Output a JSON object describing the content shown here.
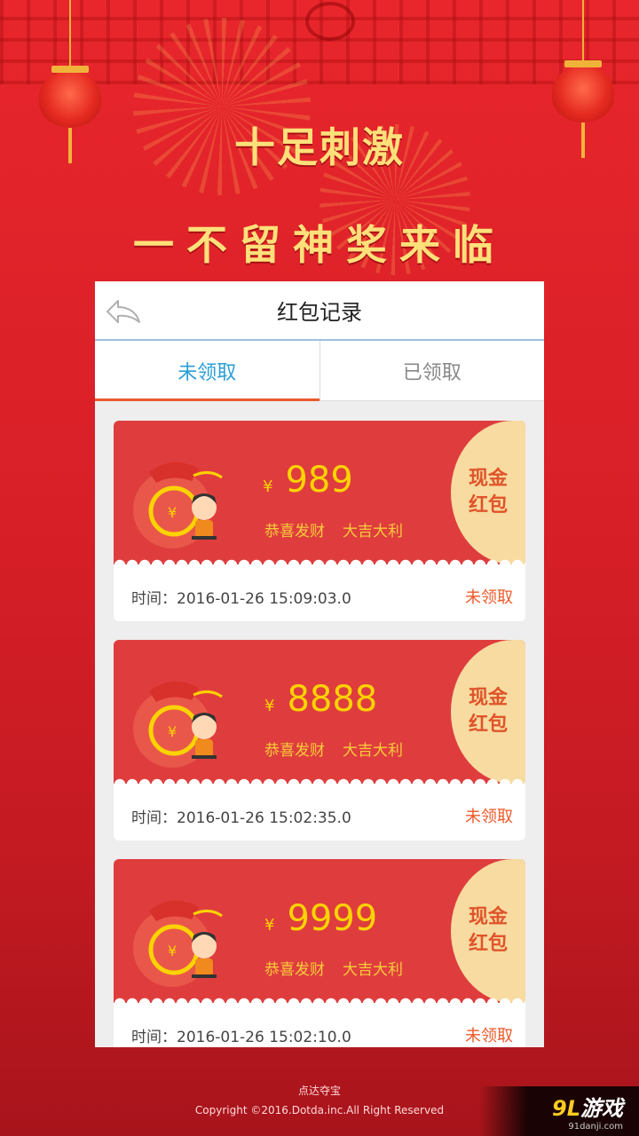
{
  "banner": {
    "headline_1": "十足刺激",
    "headline_2": "一不留神奖来临"
  },
  "panel": {
    "title": "红包记录",
    "tabs": [
      {
        "label": "未领取",
        "active": true
      },
      {
        "label": "已领取",
        "active": false
      }
    ]
  },
  "records": [
    {
      "currency": "¥",
      "amount": "989",
      "blessing_1": "恭喜发财",
      "blessing_2": "大吉大利",
      "badge": "现金红包",
      "time": "时间：2016-01-26 15:09:03.0",
      "status": "未领取"
    },
    {
      "currency": "¥",
      "amount": "8888",
      "blessing_1": "恭喜发财",
      "blessing_2": "大吉大利",
      "badge": "现金红包",
      "time": "时间：2016-01-26 15:02:35.0",
      "status": "未领取"
    },
    {
      "currency": "¥",
      "amount": "9999",
      "blessing_1": "恭喜发财",
      "blessing_2": "大吉大利",
      "badge": "现金红包",
      "time": "时间：2016-01-26 15:02:10.0",
      "status": "未领取"
    }
  ],
  "footer": {
    "app_name": "点达夺宝",
    "copyright": "Copyright ©2016.Dotda.inc.All Right Reserved"
  },
  "watermark": {
    "logo_number": "9L",
    "logo_text": "游戏",
    "url": "91danji.com"
  },
  "colors": {
    "background": "#e8262c",
    "headline": "#fde07a",
    "card_red": "#df3d3d",
    "amount_yellow": "#fbd300",
    "badge_bg": "#f7dba0",
    "status_orange": "#ef5a2a",
    "active_tab": "#2a9fd6"
  }
}
